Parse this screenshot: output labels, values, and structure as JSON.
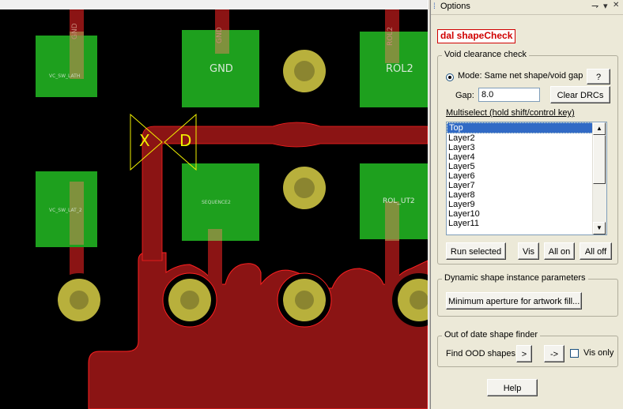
{
  "canvas": {
    "pad_labels": {
      "gnd": "GND",
      "rol2": "ROL2",
      "rol_ut2": "ROL_UT2",
      "small_1": "VC_SW_LATH",
      "small_2": "VC_SW_LAT_2",
      "small_3": "SEQUENCE2",
      "vlabel_1": "GND",
      "vlabel_2": "GND",
      "vlabel_3": "ROL2"
    },
    "marker_glyphs": {
      "x": "X",
      "d": "D"
    },
    "colors": {
      "background": "#000000",
      "copper": "#8b1414",
      "pad_green": "#1ea01e",
      "via_ring": "#b8b03c",
      "drc_marker": "#f0f000"
    }
  },
  "panel": {
    "title": "Options",
    "pin_glyph": "⇁",
    "menu_glyph": "▾",
    "close_glyph": "✕",
    "app_title": "dal shapeCheck",
    "void": {
      "group_title": "Void clearance check",
      "mode_label": "Mode: Same net shape/void gap",
      "help_btn": "?",
      "gap_label": "Gap:",
      "gap_value": "8.0",
      "clear_drcs": "Clear DRCs",
      "multiselect_label": "Multiselect (hold shift/control key)",
      "layers": [
        "Top",
        "Layer2",
        "Layer3",
        "Layer4",
        "Layer5",
        "Layer6",
        "Layer7",
        "Layer8",
        "Layer9",
        "Layer10",
        "Layer11"
      ],
      "selected_layer": "Top",
      "run_selected": "Run selected",
      "vis": "Vis",
      "all_on": "All on",
      "all_off": "All off"
    },
    "dynamic": {
      "group_title": "Dynamic shape instance parameters",
      "min_aperture": "Minimum aperture for artwork fill..."
    },
    "ood": {
      "group_title": "Out of date shape finder",
      "find_label": "Find OOD shapes",
      "next_btn": ">",
      "jump_btn": "->",
      "vis_only": "Vis only"
    },
    "help": "Help"
  }
}
